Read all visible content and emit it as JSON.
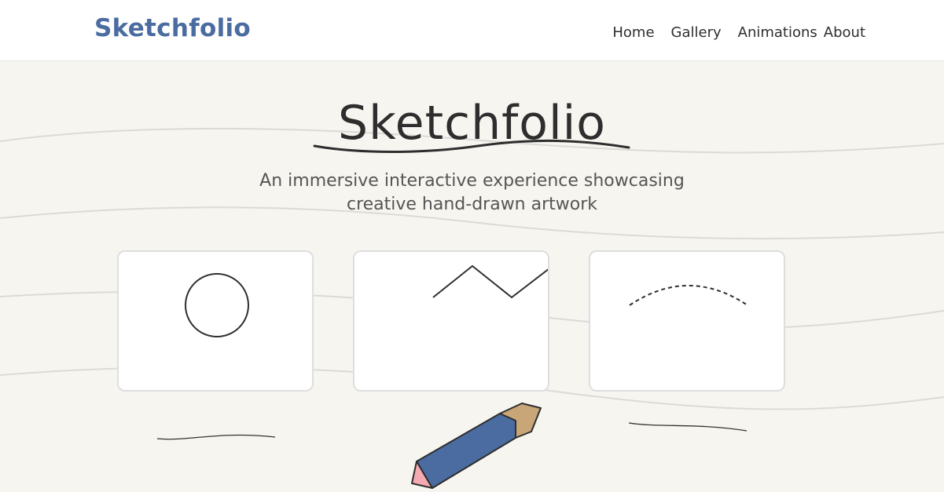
{
  "header": {
    "brand": "Sketchfolio",
    "nav": [
      {
        "label": "Home"
      },
      {
        "label": "Gallery"
      },
      {
        "label": "Animations"
      },
      {
        "label": "About"
      }
    ]
  },
  "hero": {
    "title": "Sketchfolio",
    "subtitle_line1": "An immersive interactive experience showcasing",
    "subtitle_line2": "creative hand-drawn artwork"
  },
  "gallery": {
    "cards": [
      {
        "icon": "circle-sketch-icon"
      },
      {
        "icon": "zigzag-sketch-icon"
      },
      {
        "icon": "dashed-arc-sketch-icon"
      }
    ]
  },
  "colors": {
    "background": "#f7f5f0",
    "brand": "#4a6ca0",
    "text": "#2e2e2e",
    "subtitle": "#555555",
    "pencil_body": "#4a6ca0",
    "pencil_wood": "#c8a678",
    "pencil_eraser": "#f4a9b3"
  }
}
